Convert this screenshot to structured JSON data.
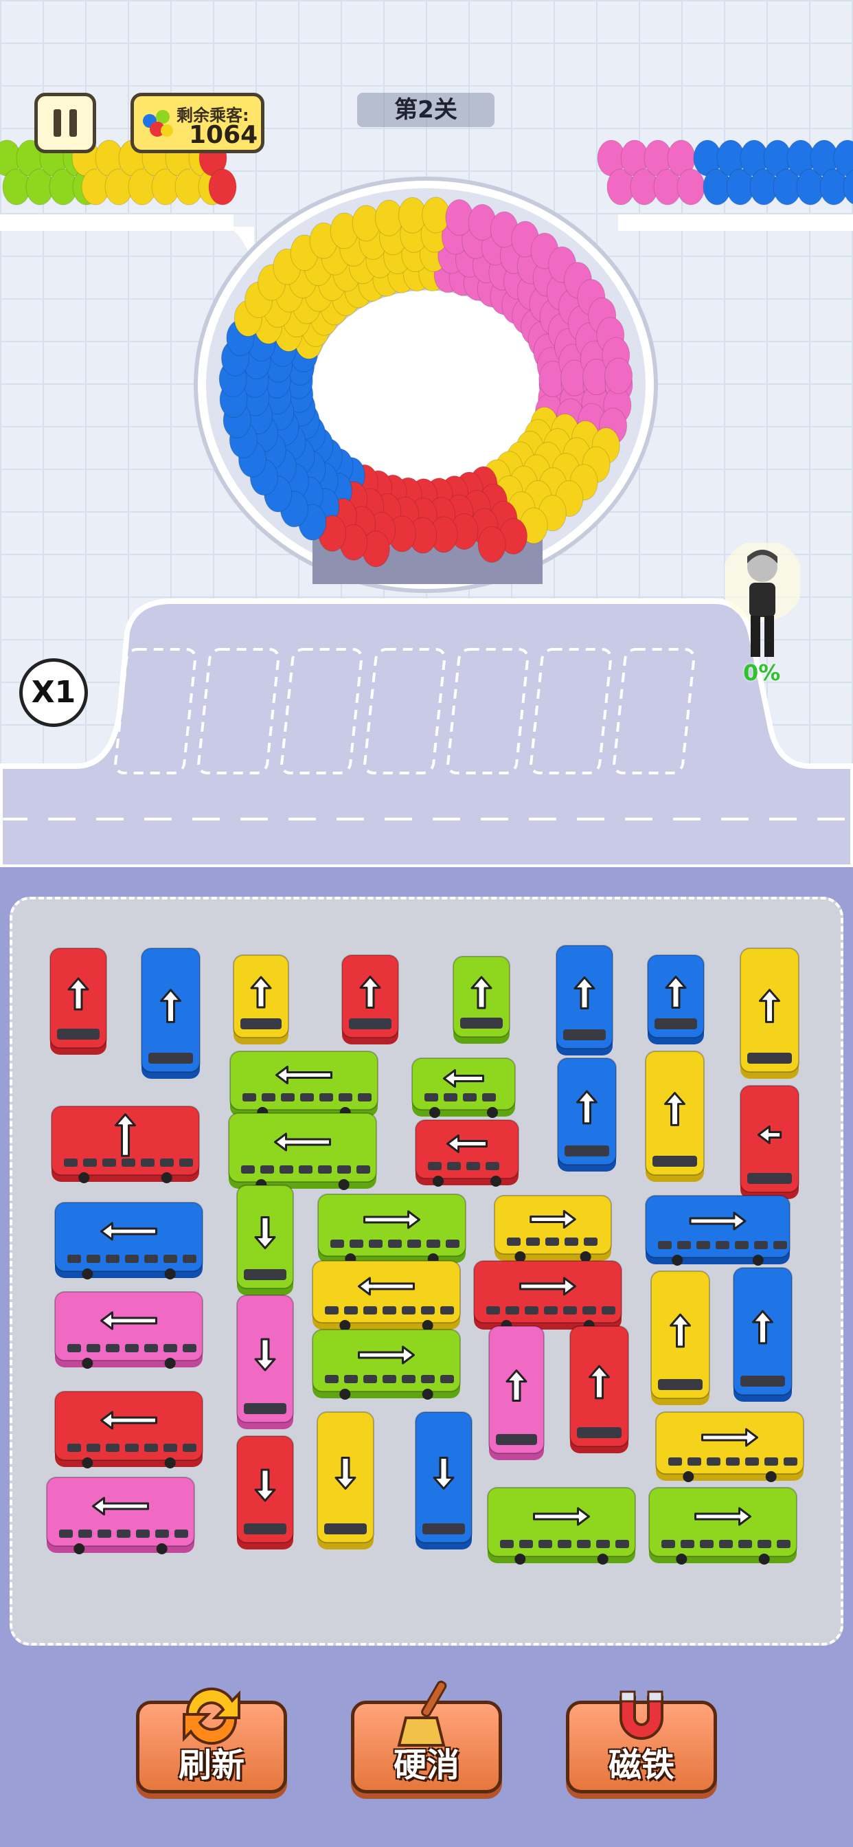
{
  "hud": {
    "passengers_label": "剩余乘客:",
    "passengers_count": "1064",
    "level": "第2关",
    "multiplier": "X1",
    "boarding_progress": "0%"
  },
  "colors": {
    "red": "#e8333a",
    "blue": "#1f74e6",
    "yellow": "#f5d31a",
    "green": "#8fd61f",
    "pink": "#f06ac4",
    "road": "#c9cbe6"
  },
  "parking_slots_empty": 7,
  "board": {
    "vehicles": [
      {
        "color": "red",
        "dir": "up"
      },
      {
        "color": "blue",
        "dir": "up"
      },
      {
        "color": "yellow",
        "dir": "up"
      },
      {
        "color": "red",
        "dir": "up"
      },
      {
        "color": "green",
        "dir": "up"
      },
      {
        "color": "blue",
        "dir": "up"
      },
      {
        "color": "blue",
        "dir": "up"
      },
      {
        "color": "yellow",
        "dir": "up"
      },
      {
        "color": "green",
        "dir": "left"
      },
      {
        "color": "green",
        "dir": "left"
      },
      {
        "color": "blue",
        "dir": "up"
      },
      {
        "color": "yellow",
        "dir": "up"
      },
      {
        "color": "red",
        "dir": "up"
      },
      {
        "color": "green",
        "dir": "left"
      },
      {
        "color": "red",
        "dir": "left"
      },
      {
        "color": "red",
        "dir": "left"
      },
      {
        "color": "blue",
        "dir": "left"
      },
      {
        "color": "green",
        "dir": "down"
      },
      {
        "color": "green",
        "dir": "right"
      },
      {
        "color": "yellow",
        "dir": "right"
      },
      {
        "color": "blue",
        "dir": "right"
      },
      {
        "color": "yellow",
        "dir": "left"
      },
      {
        "color": "red",
        "dir": "right"
      },
      {
        "color": "pink",
        "dir": "left"
      },
      {
        "color": "pink",
        "dir": "down"
      },
      {
        "color": "green",
        "dir": "right"
      },
      {
        "color": "pink",
        "dir": "up"
      },
      {
        "color": "red",
        "dir": "up"
      },
      {
        "color": "yellow",
        "dir": "up"
      },
      {
        "color": "blue",
        "dir": "up"
      },
      {
        "color": "red",
        "dir": "left"
      },
      {
        "color": "red",
        "dir": "down"
      },
      {
        "color": "yellow",
        "dir": "down"
      },
      {
        "color": "blue",
        "dir": "down"
      },
      {
        "color": "yellow",
        "dir": "right"
      },
      {
        "color": "pink",
        "dir": "left"
      },
      {
        "color": "green",
        "dir": "right"
      },
      {
        "color": "green",
        "dir": "right"
      }
    ]
  },
  "powerups": [
    {
      "label": "刷新",
      "icon": "refresh-icon"
    },
    {
      "label": "硬消",
      "icon": "broom-icon"
    },
    {
      "label": "磁铁",
      "icon": "magnet-icon"
    }
  ]
}
